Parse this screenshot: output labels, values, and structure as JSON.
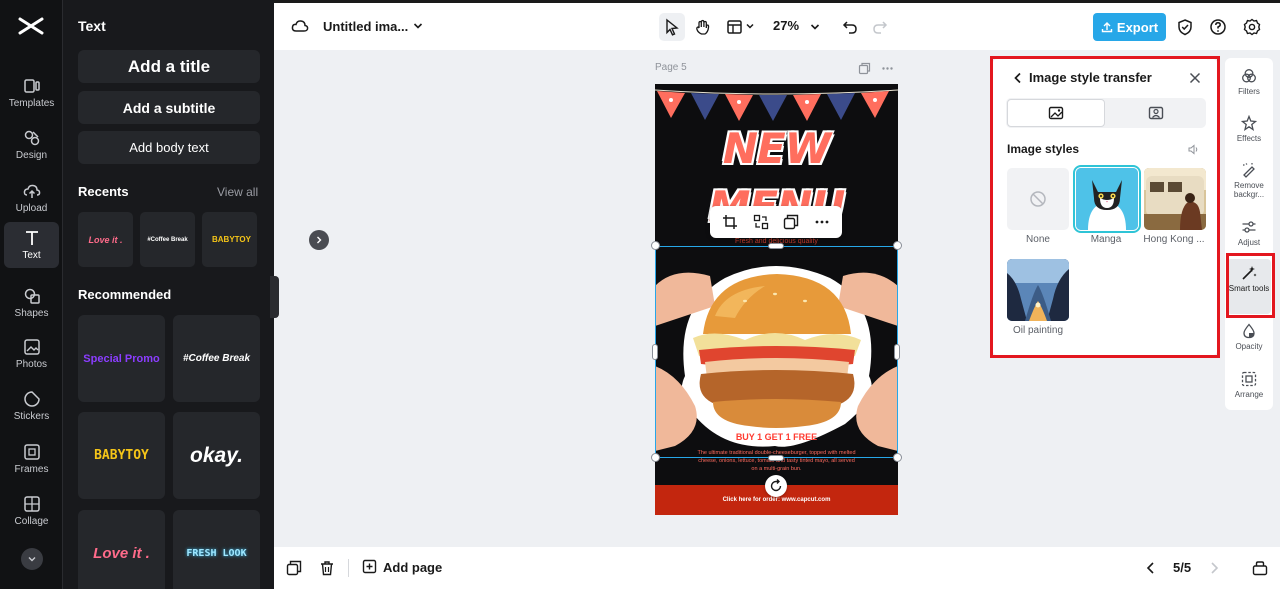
{
  "rail": {
    "items": [
      {
        "label": "Templates",
        "icon": "templates-icon"
      },
      {
        "label": "Design",
        "icon": "design-icon"
      },
      {
        "label": "Upload",
        "icon": "upload-icon"
      },
      {
        "label": "Text",
        "icon": "text-icon",
        "active": true
      },
      {
        "label": "Shapes",
        "icon": "shapes-icon"
      },
      {
        "label": "Photos",
        "icon": "photos-icon"
      },
      {
        "label": "Stickers",
        "icon": "stickers-icon"
      },
      {
        "label": "Frames",
        "icon": "frames-icon"
      },
      {
        "label": "Collage",
        "icon": "collage-icon"
      }
    ]
  },
  "text_panel": {
    "title": "Text",
    "add_title": "Add a title",
    "add_subtitle": "Add a subtitle",
    "add_body": "Add body text",
    "recents_label": "Recents",
    "view_all": "View all",
    "recents": [
      "Love it .",
      "#Coffee Break",
      "BABYTOY"
    ],
    "recommended_label": "Recommended",
    "recommended": [
      "Special Promo",
      "#Coffee Break",
      "BABYTOY",
      "okay.",
      "Love it .",
      "FRESH LOOK"
    ]
  },
  "topbar": {
    "title": "Untitled ima...",
    "zoom": "27%",
    "export_label": "Export"
  },
  "canvas": {
    "page_label": "Page 5",
    "poster": {
      "headline_1": "NEW",
      "headline_2": "MENU",
      "tagline": "Fresh and delicious quality",
      "offer": "BUY 1 GET 1 FREE",
      "description": "The ultimate traditional double-cheeseburger, topped with melted cheese, onions, lettuce, tomato and tasty tinted mayo, all served on a multi-grain bun.",
      "footer": "Click here for order:  www.capcut.com"
    }
  },
  "style_panel": {
    "title": "Image style transfer",
    "section_label": "Image styles",
    "styles": [
      {
        "label": "None"
      },
      {
        "label": "Manga",
        "selected": true
      },
      {
        "label": "Hong Kong ..."
      },
      {
        "label": "Oil painting"
      }
    ]
  },
  "tool_rail": {
    "items": [
      {
        "label": "Filters"
      },
      {
        "label": "Effects"
      },
      {
        "label": "Remove backgr..."
      },
      {
        "label": "Adjust"
      },
      {
        "label": "Smart tools",
        "active": true
      },
      {
        "label": "Opacity"
      },
      {
        "label": "Arrange"
      }
    ]
  },
  "bottombar": {
    "add_page": "Add page",
    "page_count": "5/5"
  },
  "colors": {
    "accent": "#27a7e8",
    "highlight": "#e3171f",
    "selected_outline": "#2fc4d6",
    "poster_red": "#c3260e"
  }
}
